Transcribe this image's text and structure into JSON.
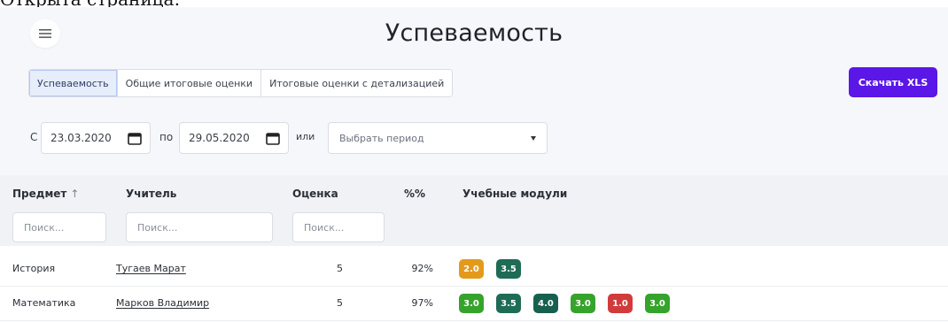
{
  "cropped_header_text": "Открыта страница:",
  "page": {
    "title": "Успеваемость"
  },
  "tabs": [
    {
      "label": "Успеваемость",
      "active": true
    },
    {
      "label": "Общие итоговые оценки",
      "active": false
    },
    {
      "label": "Итоговые оценки с детализацией",
      "active": false
    }
  ],
  "toolbar": {
    "xls_label": "Скачать XLS"
  },
  "filters": {
    "from_label": "С",
    "from_date": "23.03.2020",
    "to_label": "по",
    "to_date": "29.05.2020",
    "or_label": "или",
    "period_placeholder": "Выбрать период"
  },
  "table": {
    "columns": {
      "subject": "Предмет",
      "subject_sort": "↑",
      "teacher": "Учитель",
      "grade": "Оценка",
      "percent": "%%",
      "modules": "Учебные модули"
    },
    "search_placeholder": "Поиск...",
    "rows": [
      {
        "subject": "История",
        "teacher": "Тугаев Марат",
        "grade": "5",
        "percent": "92%",
        "modules": [
          {
            "value": "2.0",
            "color": "#e39a1c"
          },
          {
            "value": "3.5",
            "color": "#1f6b55"
          }
        ]
      },
      {
        "subject": "Математика",
        "teacher": "Марков Владимир",
        "grade": "5",
        "percent": "97%",
        "modules": [
          {
            "value": "3.0",
            "color": "#36a32c"
          },
          {
            "value": "3.5",
            "color": "#1f6b55"
          },
          {
            "value": "4.0",
            "color": "#17604f"
          },
          {
            "value": "3.0",
            "color": "#36a32c"
          },
          {
            "value": "1.0",
            "color": "#d13b3b"
          },
          {
            "value": "3.0",
            "color": "#36a32c"
          }
        ]
      }
    ]
  },
  "colors": {
    "accent": "#5b16e8",
    "active_tab_bg": "#e6edfb"
  },
  "icons": {
    "menu": "hamburger-icon",
    "calendar": "calendar-icon",
    "dropdown": "caret-down-icon"
  }
}
